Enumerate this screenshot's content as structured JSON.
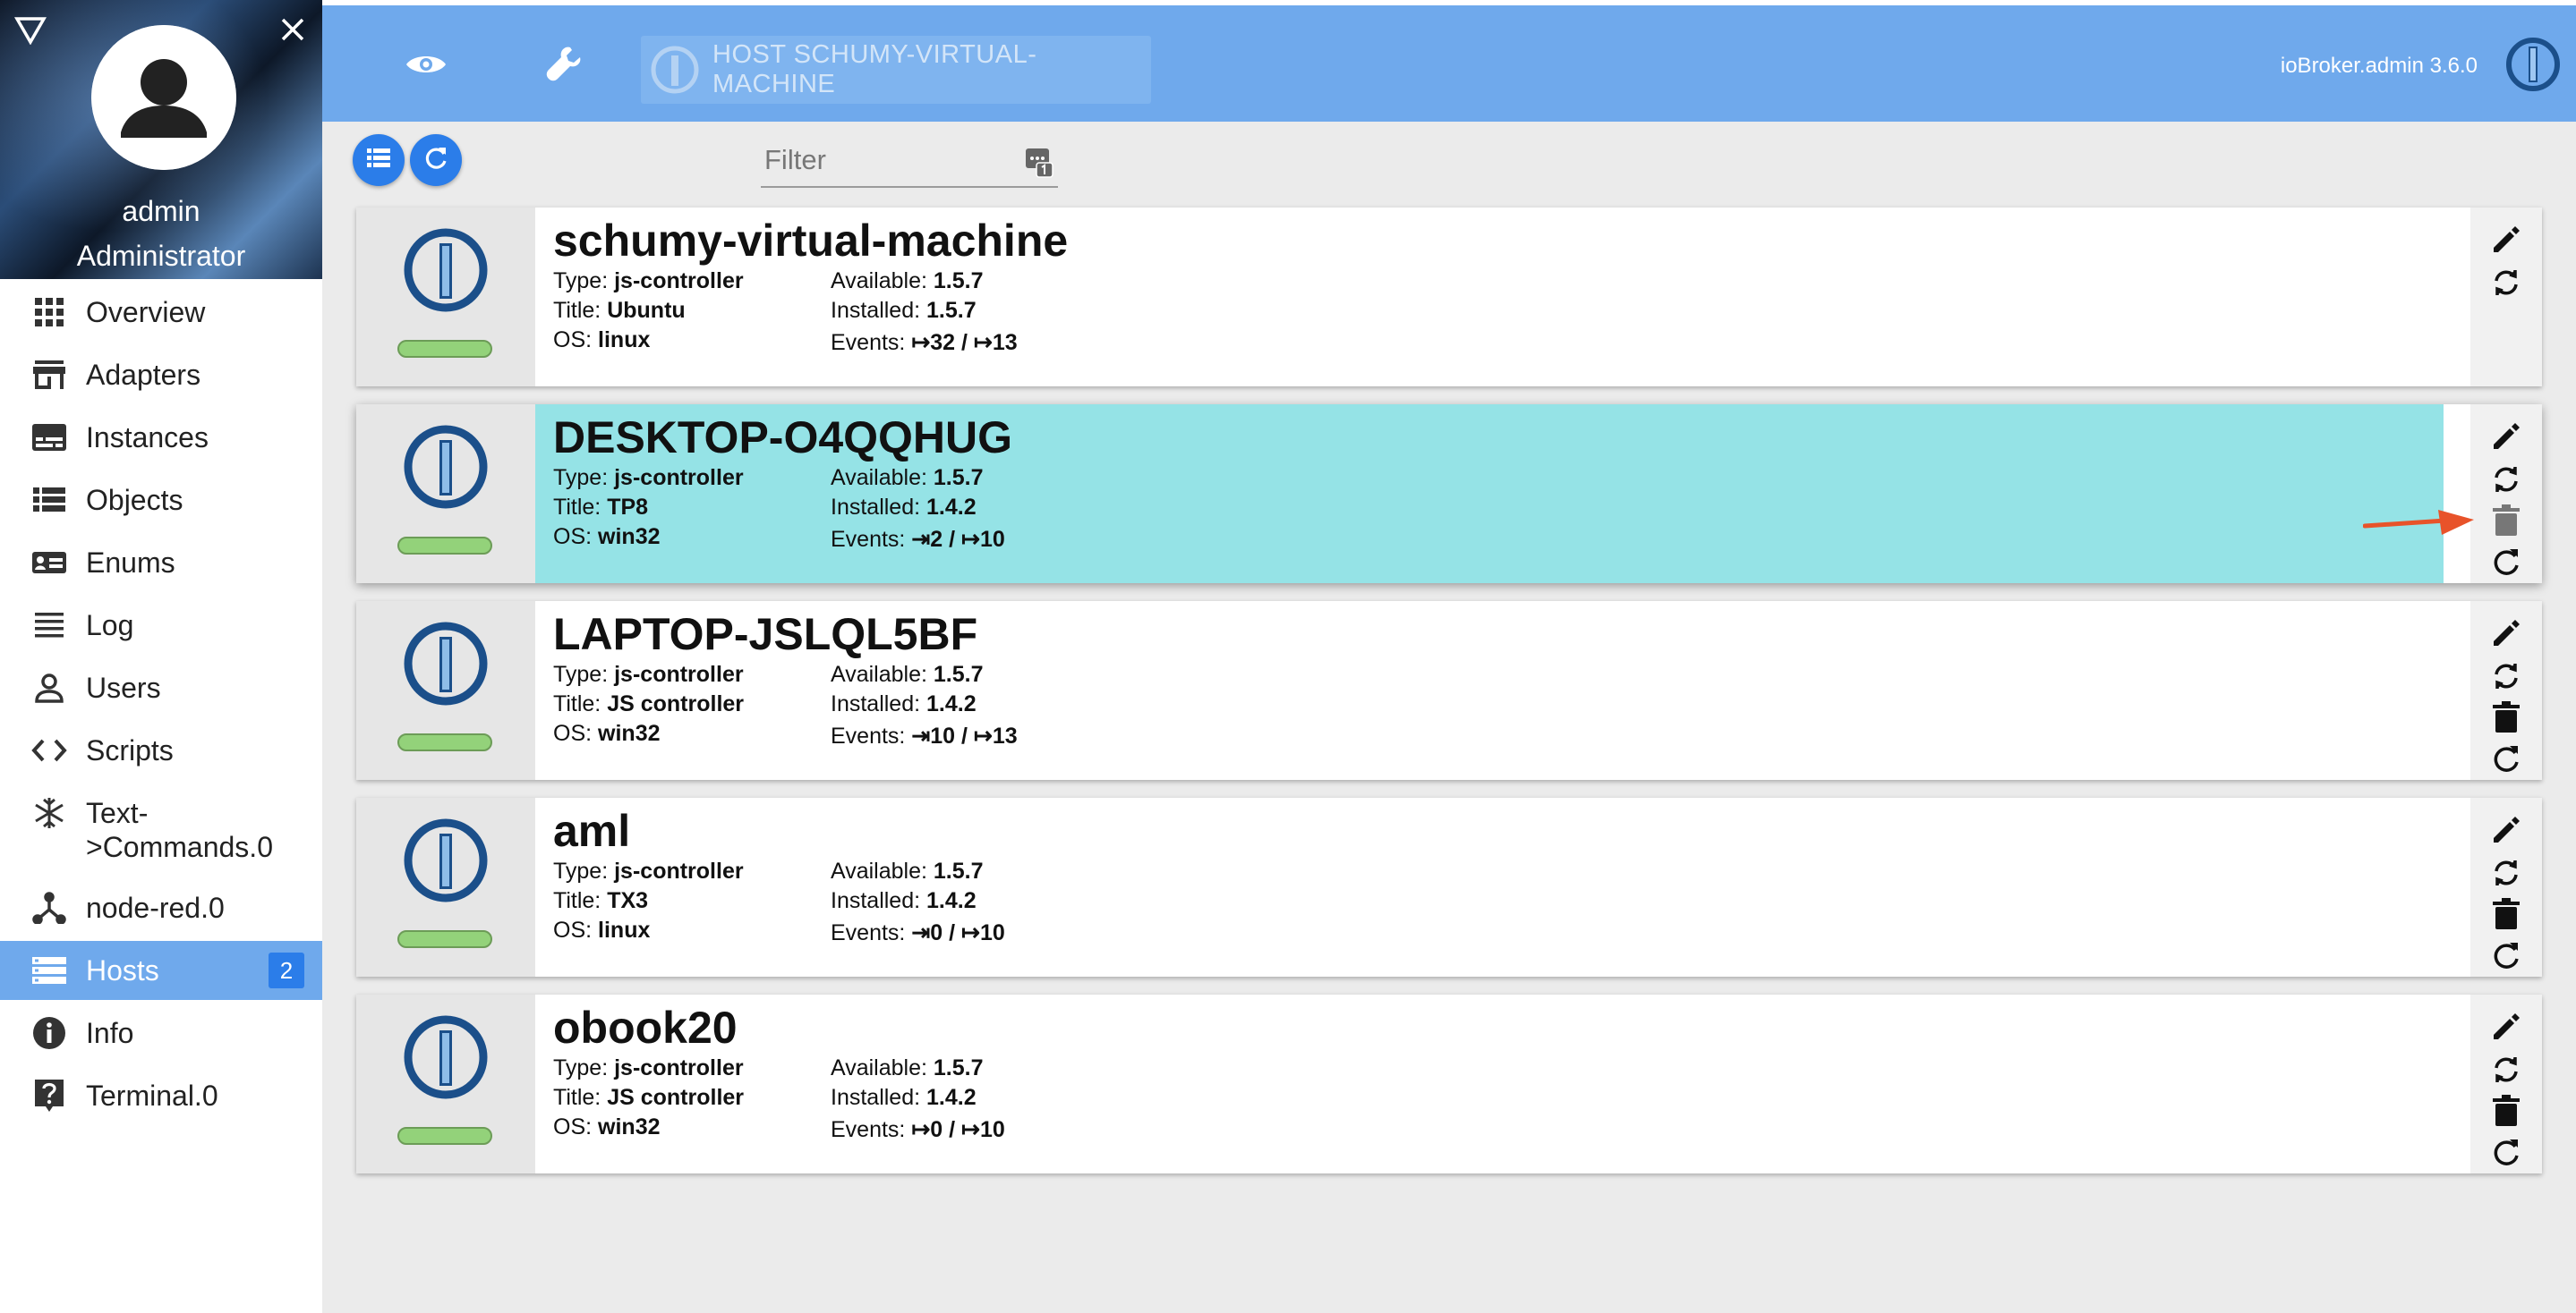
{
  "user": {
    "name": "admin",
    "role": "Administrator"
  },
  "sidebar": {
    "items": [
      {
        "label": "Overview",
        "icon": "grid-icon"
      },
      {
        "label": "Adapters",
        "icon": "store-icon"
      },
      {
        "label": "Instances",
        "icon": "instances-icon"
      },
      {
        "label": "Objects",
        "icon": "list-icon"
      },
      {
        "label": "Enums",
        "icon": "enums-icon"
      },
      {
        "label": "Log",
        "icon": "log-icon"
      },
      {
        "label": "Users",
        "icon": "user-icon"
      },
      {
        "label": "Scripts",
        "icon": "code-icon"
      },
      {
        "label": "Text->Commands.0",
        "label_line1": "Text-",
        "label_line2": ">Commands.0",
        "icon": "snowflake-icon"
      },
      {
        "label": "node-red.0",
        "icon": "node-icon"
      },
      {
        "label": "Hosts",
        "icon": "hosts-icon",
        "badge": "2",
        "active": true
      },
      {
        "label": "Info",
        "icon": "info-icon"
      },
      {
        "label": "Terminal.0",
        "icon": "help-icon"
      }
    ]
  },
  "topbar": {
    "host_label": "HOST SCHUMY-VIRTUAL-MACHINE",
    "version": "ioBroker.admin 3.6.0",
    "background_color": "#6fa9ec"
  },
  "toolbar": {
    "filter_placeholder": "Filter"
  },
  "labels": {
    "type": "Type:",
    "title": "Title:",
    "os": "OS:",
    "available": "Available:",
    "installed": "Installed:",
    "events": "Events:"
  },
  "hosts": [
    {
      "name": "schumy-virtual-machine",
      "type": "js-controller",
      "title": "Ubuntu",
      "os": "linux",
      "available": "1.5.7",
      "installed": "1.5.7",
      "events": "↦32 / ↦13",
      "selected": false,
      "deletable": false
    },
    {
      "name": "DESKTOP-O4QQHUG",
      "type": "js-controller",
      "title": "TP8",
      "os": "win32",
      "available": "1.5.7",
      "installed": "1.4.2",
      "events": "⇥2 / ↦10",
      "selected": true,
      "deletable": true
    },
    {
      "name": "LAPTOP-JSLQL5BF",
      "type": "js-controller",
      "title": "JS controller",
      "os": "win32",
      "available": "1.5.7",
      "installed": "1.4.2",
      "events": "⇥10 / ↦13",
      "selected": false,
      "deletable": true
    },
    {
      "name": "aml",
      "type": "js-controller",
      "title": "TX3",
      "os": "linux",
      "available": "1.5.7",
      "installed": "1.4.2",
      "events": "⇥0 / ↦10",
      "selected": false,
      "deletable": true
    },
    {
      "name": "obook20",
      "type": "js-controller",
      "title": "JS controller",
      "os": "win32",
      "available": "1.5.7",
      "installed": "1.4.2",
      "events": "↦0 / ↦10",
      "selected": false,
      "deletable": true
    }
  ],
  "colors": {
    "accent": "#2b7de9",
    "selected_row": "#95e3e6",
    "status_ok": "#93d27a",
    "arrow": "#e8532a"
  }
}
